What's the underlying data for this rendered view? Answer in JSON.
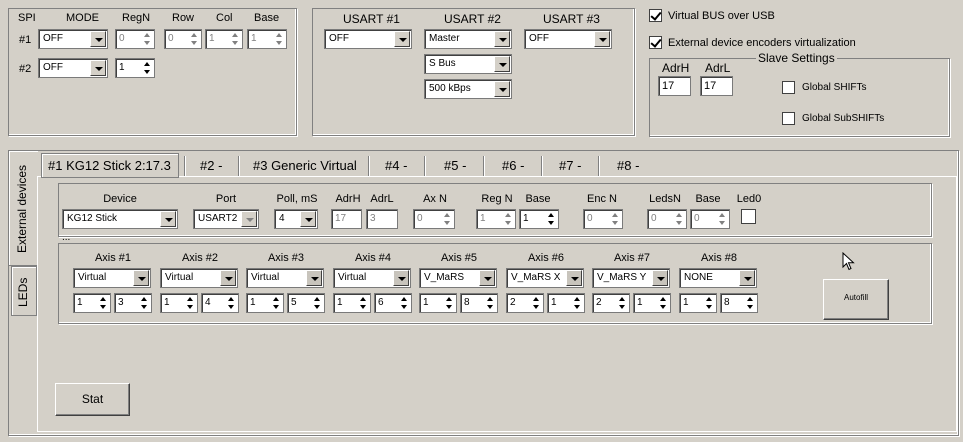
{
  "spi": {
    "headers": {
      "spi": "SPI",
      "mode": "MODE",
      "regn": "RegN",
      "row": "Row",
      "col": "Col",
      "base": "Base"
    },
    "row1": {
      "label": "#1",
      "mode": "OFF",
      "regn": "0",
      "row": "0",
      "col": "1",
      "base": "1"
    },
    "row2": {
      "label": "#2",
      "mode": "OFF",
      "regn": "1"
    }
  },
  "usart": {
    "headers": {
      "u1": "USART #1",
      "u2": "USART #2",
      "u3": "USART #3"
    },
    "u1_value": "OFF",
    "u2_value": "Master",
    "u2_protocol": "S Bus",
    "u2_baud": "500 kBps",
    "u3_value": "OFF"
  },
  "settings": {
    "virtual_bus": {
      "label": "Virtual BUS over USB",
      "checked": true
    },
    "encoders_virtualization": {
      "label": "External device encoders virtualization",
      "checked": true
    },
    "slave_settings_title": "Slave Settings",
    "adrh_label": "AdrH",
    "adrl_label": "AdrL",
    "adrh_value": "17",
    "adrl_value": "17",
    "global_shifts": {
      "label": "Global SHIFTs",
      "checked": false
    },
    "global_subshifts": {
      "label": "Global SubSHIFTs",
      "checked": false
    }
  },
  "side_tabs": [
    "External devices",
    "LEDs"
  ],
  "device_tabs": [
    "#1 KG12 Stick 2:17.3",
    "#2 -",
    "#3 Generic Virtual",
    "#4 -",
    "#5 -",
    "#6 -",
    "#7 -",
    "#8 -"
  ],
  "device": {
    "headers": {
      "device": "Device",
      "port": "Port",
      "poll": "Poll, mS",
      "adrh": "AdrH",
      "adrl": "AdrL",
      "axn": "Ax N",
      "regn": "Reg N",
      "base": "Base",
      "encn": "Enc N",
      "ledsn": "LedsN",
      "base2": "Base",
      "led0": "Led0"
    },
    "device_value": "KG12 Stick",
    "port_value": "USART2",
    "poll_value": "4",
    "adrh_value": "17",
    "adrl_value": "3",
    "axn_value": "0",
    "regn_value": "1",
    "base_value": "1",
    "encn_value": "0",
    "ledsn_value": "0",
    "base2_value": "0",
    "led0_checked": false,
    "ellipsis": "..."
  },
  "axes": [
    {
      "label": "Axis #1",
      "type": "Virtual",
      "v1": "1",
      "v2": "3"
    },
    {
      "label": "Axis #2",
      "type": "Virtual",
      "v1": "1",
      "v2": "4"
    },
    {
      "label": "Axis #3",
      "type": "Virtual",
      "v1": "1",
      "v2": "5"
    },
    {
      "label": "Axis #4",
      "type": "Virtual",
      "v1": "1",
      "v2": "6"
    },
    {
      "label": "Axis #5",
      "type": "V_MaRS",
      "v1": "1",
      "v2": "8"
    },
    {
      "label": "Axis #6",
      "type": "V_MaRS X",
      "v1": "2",
      "v2": "1"
    },
    {
      "label": "Axis #7",
      "type": "V_MaRS Y",
      "v1": "2",
      "v2": "1"
    },
    {
      "label": "Axis #8",
      "type": "NONE",
      "v1": "1",
      "v2": "8"
    }
  ],
  "autofill_label": "Autofill",
  "stat_label": "Stat"
}
